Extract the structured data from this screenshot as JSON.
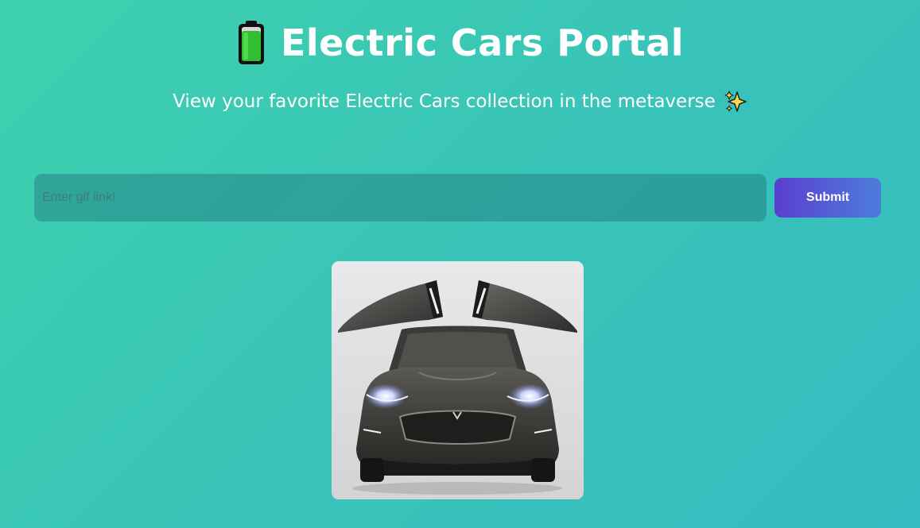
{
  "header": {
    "title": "Electric Cars Portal",
    "title_icon": "battery-icon",
    "subtitle": "View your favorite Electric Cars collection in the metaverse",
    "subtitle_icon": "sparkles-icon"
  },
  "form": {
    "input_placeholder": "Enter gif link!",
    "submit_label": "Submit"
  },
  "gallery": {
    "items": [
      {
        "image": "electric-car-gif",
        "depicts": "gullwing-door-electric-suv-front"
      }
    ]
  },
  "colors": {
    "background_start": "#3dd1ae",
    "background_end": "#36bbc0",
    "button_start": "#5b3fd0",
    "button_end": "#4d7cdb",
    "text": "#ffffff"
  }
}
